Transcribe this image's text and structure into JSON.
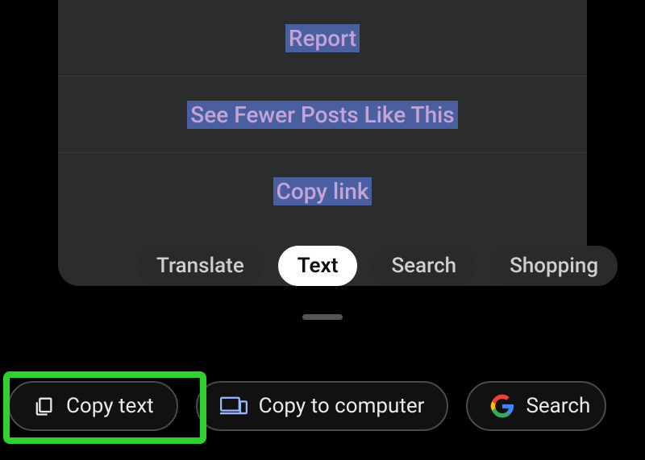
{
  "sheet": {
    "items": [
      {
        "label": "Report"
      },
      {
        "label": "See Fewer Posts Like This"
      },
      {
        "label": "Copy link"
      }
    ]
  },
  "modes": {
    "items": [
      {
        "label": "Translate",
        "active": false
      },
      {
        "label": "Text",
        "active": true
      },
      {
        "label": "Search",
        "active": false
      },
      {
        "label": "Shopping",
        "active": false
      }
    ]
  },
  "actions": {
    "copy_text": {
      "label": "Copy text"
    },
    "copy_computer": {
      "label": "Copy to computer"
    },
    "search": {
      "label": "Search"
    }
  },
  "colors": {
    "highlight_bg": "#4a5fa0",
    "highlight_fg": "#c4a4d6",
    "annotation": "#2fd12f"
  }
}
